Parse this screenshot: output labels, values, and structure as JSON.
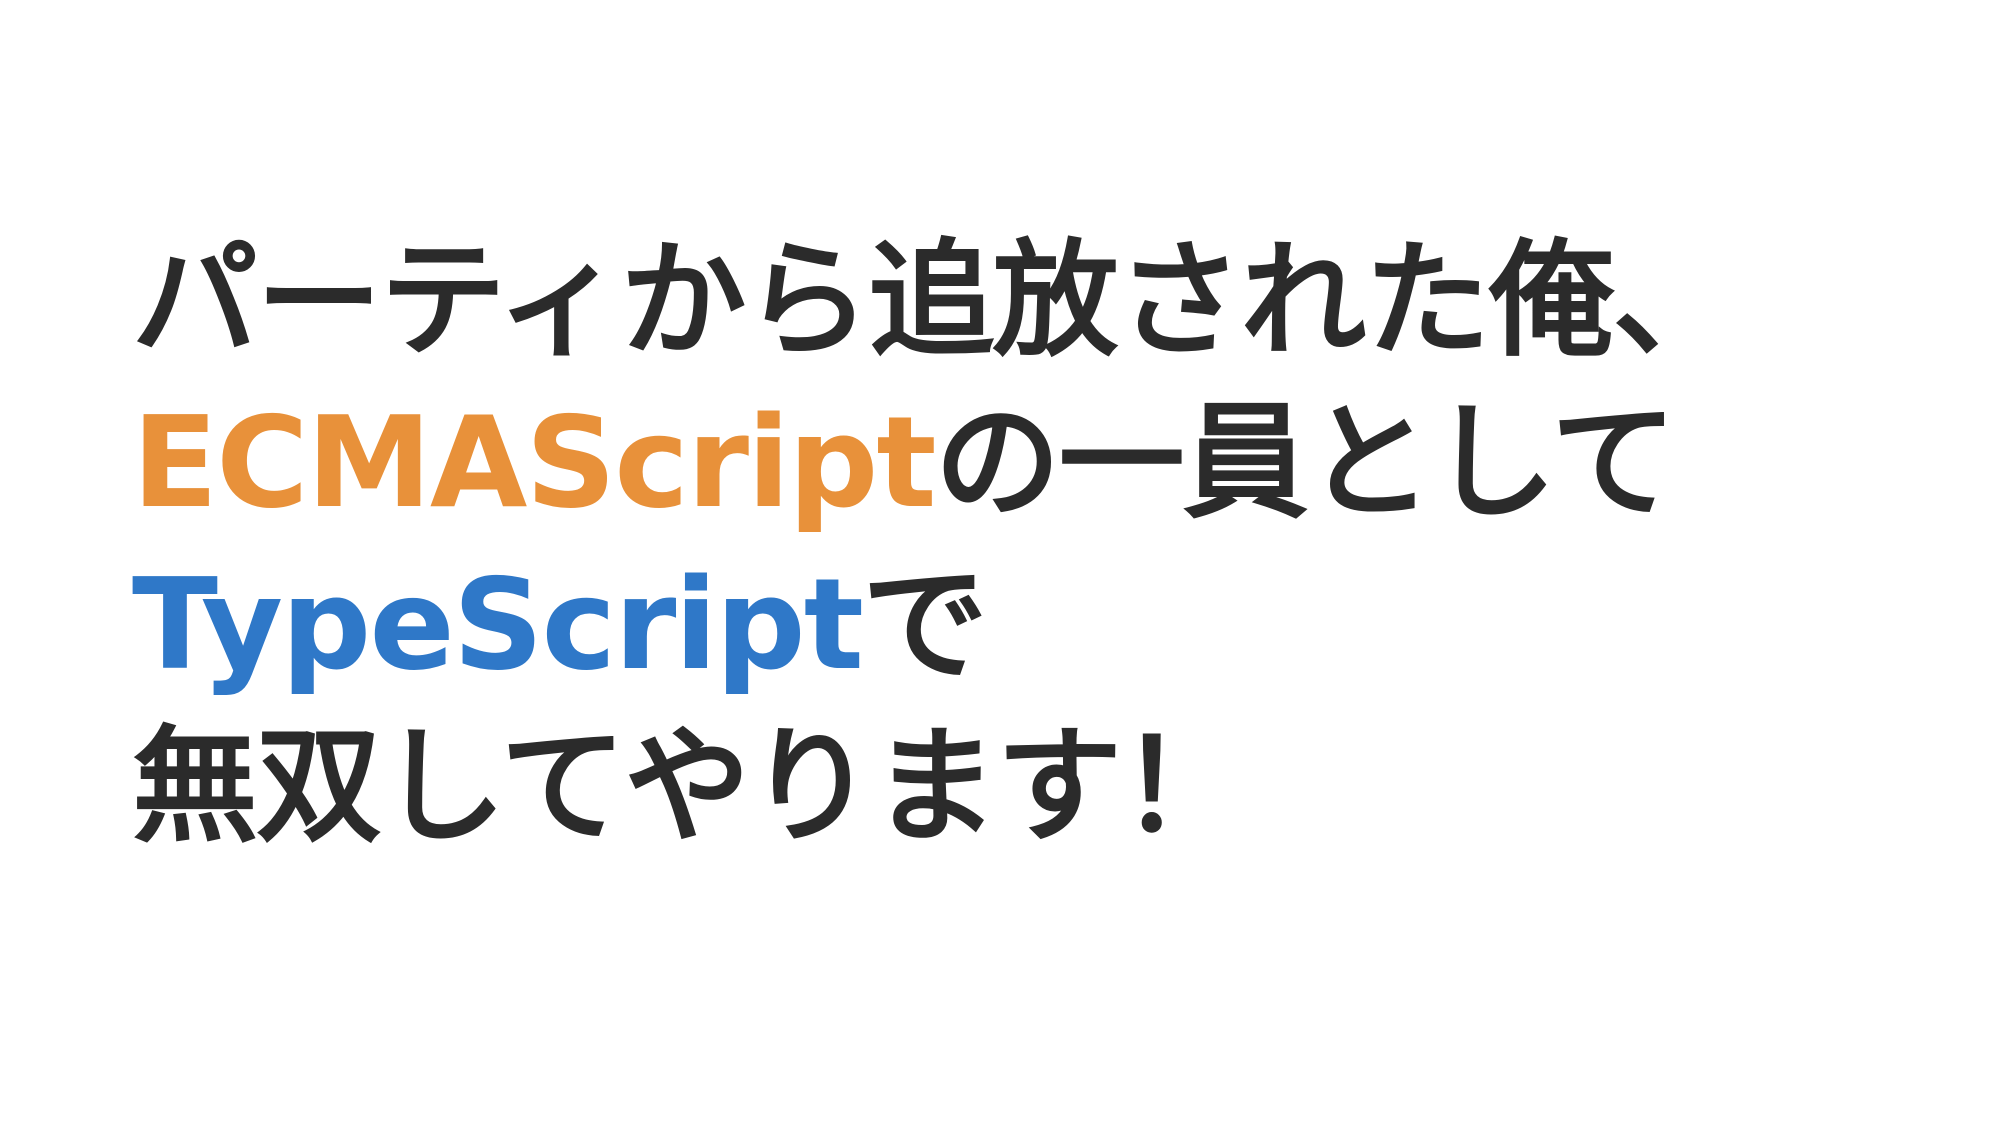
{
  "slide": {
    "line1": "パーティから追放された俺、",
    "line2_accent": "ECMAScript",
    "line2_rest": "の一員として",
    "line3_accent": "TypeScript",
    "line3_rest": "で",
    "line4": "無双してやります！"
  },
  "colors": {
    "background": "#ffffff",
    "text": "#2b2b2b",
    "ecmascript": "#e8913a",
    "typescript": "#2f78c8"
  }
}
